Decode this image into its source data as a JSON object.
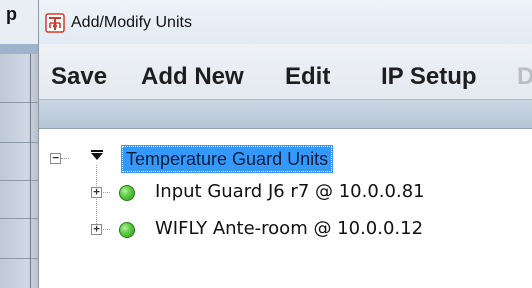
{
  "background_window": {
    "visible_letter": "p"
  },
  "window": {
    "title": "Add/Modify Units",
    "app_icon": "temperature-guard-logo-icon"
  },
  "menu": {
    "items": [
      {
        "label": "Save"
      },
      {
        "label": "Add New"
      },
      {
        "label": "Edit"
      },
      {
        "label": "IP Setup"
      },
      {
        "label": "D"
      }
    ]
  },
  "tree": {
    "root": {
      "label": "Temperature Guard Units",
      "expanded": true,
      "selected": true,
      "expander": "−"
    },
    "children": [
      {
        "label": "Input Guard J6 r7 @ 10.0.0.81",
        "status_color": "#4cc238",
        "expander": "+"
      },
      {
        "label": "WIFLY Ante-room @ 10.0.0.12",
        "status_color": "#4cc238",
        "expander": "+"
      }
    ]
  },
  "colors": {
    "selection": "#3399ff",
    "status_online": "#4cc238",
    "icon_red": "#d43a2a"
  }
}
